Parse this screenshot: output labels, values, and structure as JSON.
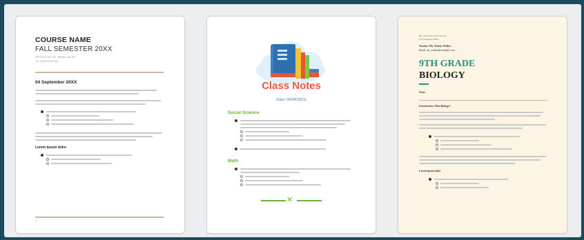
{
  "templates": [
    {
      "course_name": "COURSE NAME",
      "semester": "FALL SEMESTER 20XX",
      "meta1": "INSTRUCTOR: DR. WENDY WALSH",
      "meta2": "TA: JOSEPH SOUSA",
      "date": "04 September 20XX",
      "subheading": "Lorem ipsum dolor",
      "page_number": "1"
    },
    {
      "title": "Class Notes",
      "date": "Date: 09/04/20XX",
      "section1": "Social Science",
      "section2": "Math"
    },
    {
      "school": "Riverside Education Service",
      "term": "Fall Semester 20XX",
      "teacher": "Teacher: Ms. Wendy Walker",
      "email": "Email: ms_walker@example.com",
      "grade": "9TH GRADE",
      "subject": "BIOLOGY",
      "notes_label": "Notes",
      "topic": "Introduction: Who Biology?",
      "subheading": "Lorem ipsum dolor"
    }
  ],
  "colors": {
    "accent_tan": "#c9b994",
    "accent_blue": "#e8563a",
    "green": "#6bb336",
    "teal": "#2e8b88",
    "cream": "#fdf5e3"
  }
}
